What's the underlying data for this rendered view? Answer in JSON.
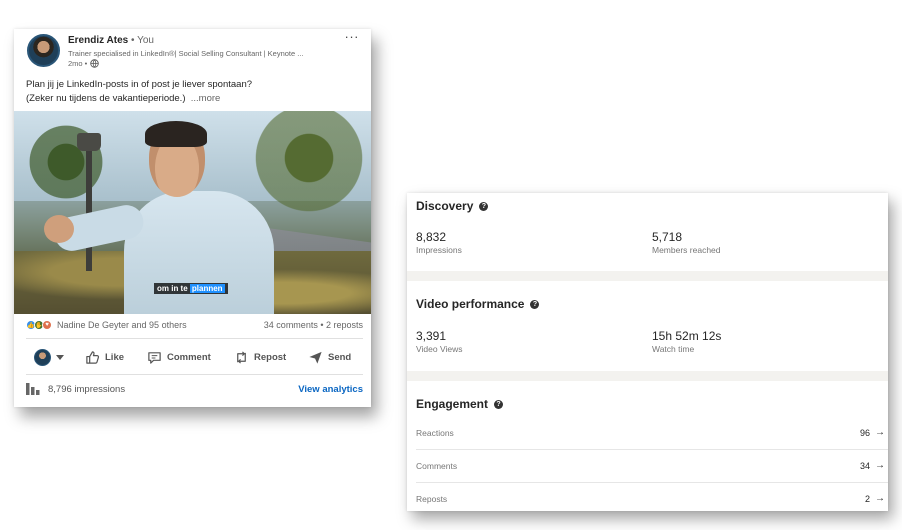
{
  "post": {
    "author_name": "Erendiz Ates",
    "author_you": " • You",
    "headline": "Trainer specialised in LinkedIn®| Social Selling Consultant | Keynote ...",
    "posted_ago": "2mo •",
    "menu": "···",
    "text_line1": "Plan jij je LinkedIn-posts in of post je liever spontaan?",
    "text_line2": "(Zeker nu tijdens de vakantieperiode.)",
    "see_more": "...more",
    "video_caption_plain": "om in te ",
    "video_caption_highlight": "plannen",
    "reactors": "Nadine De Geyter and 95 others",
    "comments_reposts": "34 comments • 2 reposts",
    "actions": {
      "like": "Like",
      "comment": "Comment",
      "repost": "Repost",
      "send": "Send"
    },
    "impressions": "8,796 impressions",
    "view_analytics": "View analytics"
  },
  "analytics": {
    "discovery": {
      "title": "Discovery",
      "impressions_value": "8,832",
      "impressions_label": "Impressions",
      "members_value": "5,718",
      "members_label": "Members reached"
    },
    "video": {
      "title": "Video performance",
      "views_value": "3,391",
      "views_label": "Video Views",
      "watch_value": "15h 52m 12s",
      "watch_label": "Watch time"
    },
    "engagement": {
      "title": "Engagement",
      "rows": [
        {
          "label": "Reactions",
          "value": "96"
        },
        {
          "label": "Comments",
          "value": "34"
        },
        {
          "label": "Reposts",
          "value": "2"
        }
      ]
    }
  },
  "colors": {
    "link_blue": "#0a66c2",
    "like_blue": "#378fe9",
    "celebrate_green": "#44712e",
    "love_orange": "#df704d",
    "panel_bg": "#f3f2ef"
  },
  "icons": {
    "reactions": [
      "like-icon",
      "celebrate-icon",
      "love-icon"
    ],
    "actions": [
      "thumbs-up-icon",
      "comment-icon",
      "repost-icon",
      "send-icon"
    ],
    "help": "question-circle-icon",
    "arrow": "arrow-right-icon",
    "impressions": "bar-chart-icon",
    "visibility": "globe-icon"
  }
}
